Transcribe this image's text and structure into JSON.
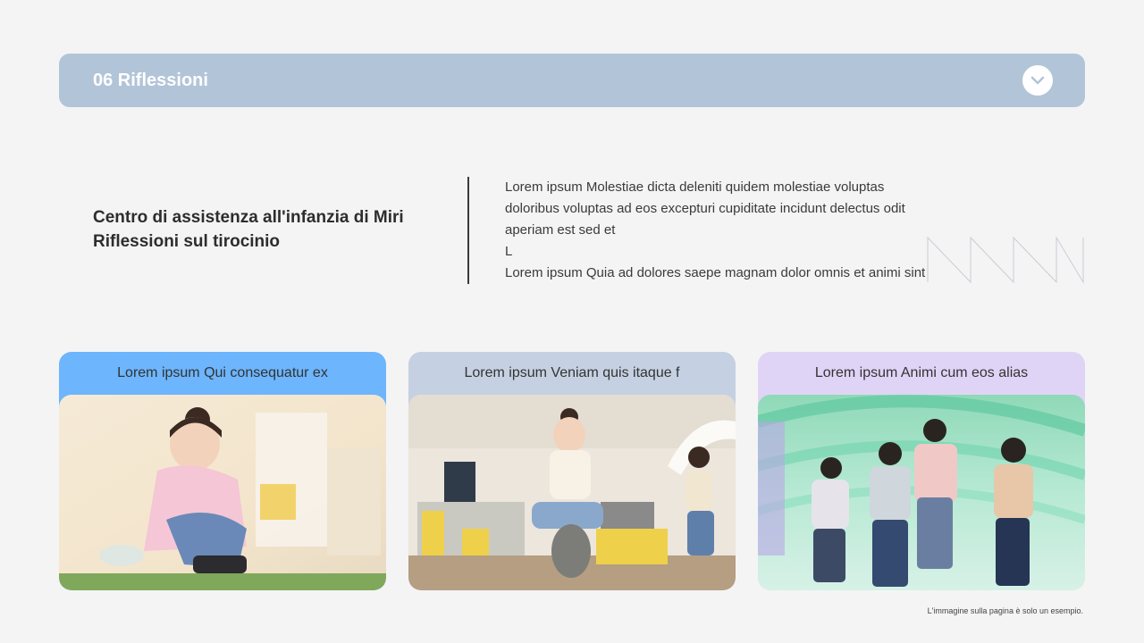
{
  "header": {
    "title": "06 Riflessioni",
    "toggle_icon": "chevron-down-icon"
  },
  "intro": {
    "title_line1": "Centro di assistenza all'infanzia di Miri",
    "title_line2": "Riflessioni sul tirocinio",
    "paragraph": "Lorem ipsum Molestiae dicta deleniti quidem molestiae voluptas\ndoloribus voluptas ad eos excepturi cupiditate incidunt delectus odit\naperiam est sed et\nL\nLorem ipsum Quia ad dolores saepe magnam dolor omnis et animi sint"
  },
  "cards": [
    {
      "label": "Lorem ipsum Qui consequatur ex",
      "color": "#6db5fc"
    },
    {
      "label": "Lorem ipsum Veniam quis itaque f",
      "color": "#c5d1e2"
    },
    {
      "label": "Lorem ipsum Animi cum eos alias",
      "color": "#e0d4f6"
    }
  ],
  "footnote": "L'immagine sulla pagina è solo un esempio.",
  "colors": {
    "background": "#f4f4f5",
    "header": "#b2c4d8",
    "text": "#333333"
  }
}
